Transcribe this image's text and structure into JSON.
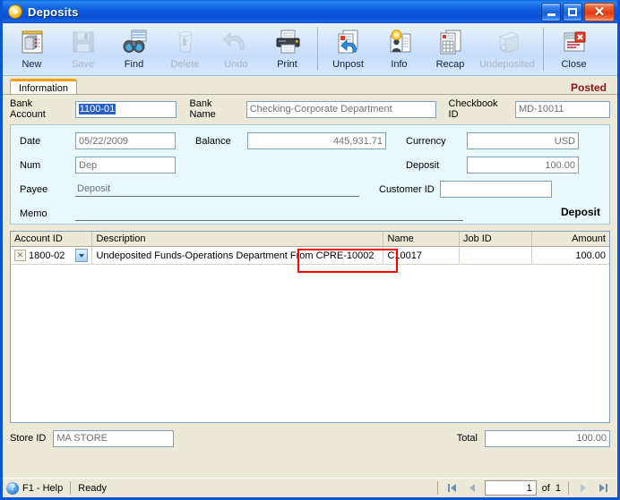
{
  "window": {
    "title": "Deposits",
    "title_icon": "play-circle-icon",
    "minimize_label": "Minimize",
    "maximize_label": "Maximize",
    "close_label": "Close"
  },
  "toolbar": {
    "items": [
      {
        "label": "New",
        "icon": "new-document-icon",
        "enabled": true
      },
      {
        "label": "Save",
        "icon": "floppy-disk-icon",
        "enabled": false
      },
      {
        "label": "Find",
        "icon": "binoculars-icon",
        "enabled": true
      },
      {
        "label": "Delete",
        "icon": "recycle-bin-icon",
        "enabled": false
      },
      {
        "label": "Undo",
        "icon": "undo-arrow-icon",
        "enabled": false
      },
      {
        "label": "Print",
        "icon": "printer-icon",
        "enabled": true
      },
      {
        "label": "Unpost",
        "icon": "unpost-icon",
        "enabled": true
      },
      {
        "label": "Info",
        "icon": "info-person-icon",
        "enabled": true
      },
      {
        "label": "Recap",
        "icon": "recap-report-icon",
        "enabled": true
      },
      {
        "label": "Undeposited",
        "icon": "safe-box-icon",
        "enabled": false
      },
      {
        "label": "Close",
        "icon": "close-window-icon",
        "enabled": true
      }
    ]
  },
  "tabs": {
    "active": "Information",
    "items": [
      {
        "label": "Information"
      }
    ],
    "status_badge": "Posted"
  },
  "form": {
    "bank_account": {
      "label": "Bank Account",
      "value": "1100-01",
      "selected": true
    },
    "bank_name": {
      "label": "Bank Name",
      "value": "Checking-Corporate Department"
    },
    "checkbook_id": {
      "label": "Checkbook ID",
      "value": "MD-10011"
    },
    "date": {
      "label": "Date",
      "value": "05/22/2009"
    },
    "balance": {
      "label": "Balance",
      "value": "445,931.71"
    },
    "currency": {
      "label": "Currency",
      "value": "USD"
    },
    "num": {
      "label": "Num",
      "value": "Dep"
    },
    "deposit_amount": {
      "label": "Deposit",
      "value": "100.00"
    },
    "payee": {
      "label": "Payee",
      "value": "Deposit"
    },
    "customer_id": {
      "label": "Customer ID",
      "value": ""
    },
    "memo": {
      "label": "Memo",
      "value": ""
    },
    "deposit_type": "Deposit"
  },
  "grid": {
    "columns": [
      {
        "label": "Account ID",
        "align": "left"
      },
      {
        "label": "Description",
        "align": "left"
      },
      {
        "label": "Name",
        "align": "left"
      },
      {
        "label": "Job ID",
        "align": "left"
      },
      {
        "label": "Amount",
        "align": "right"
      }
    ],
    "rows": [
      {
        "delete_glyph": "✕",
        "account_id": "1800-02",
        "dropdown_icon": "chevron-down-icon",
        "description": "Undeposited Funds-Operations Department From CPRE-10002",
        "name": "C10017",
        "job_id": "",
        "amount": "100.00"
      }
    ],
    "highlight": {
      "color": "#ff0000",
      "target_text": "CPRE-10002"
    }
  },
  "footer": {
    "store_id": {
      "label": "Store ID",
      "value": "MA STORE"
    },
    "total": {
      "label": "Total",
      "value": "100.00"
    }
  },
  "statusbar": {
    "help_icon": "help-question-icon",
    "help_text": "F1 - Help",
    "status_text": "Ready",
    "nav": {
      "first_icon": "first-record-icon",
      "prev_icon": "previous-record-icon",
      "page_value": "1",
      "of_label": "of",
      "page_total": "1",
      "next_icon": "next-record-icon",
      "last_icon": "last-record-icon"
    }
  },
  "colors": {
    "titlebar_blue": "#0a55d6",
    "detail_panel": "#e9f8fb",
    "posted_red": "#8f1212",
    "highlight_red": "#ff0000",
    "tab_accent": "#f0a017",
    "chrome": "#ece9d8"
  }
}
